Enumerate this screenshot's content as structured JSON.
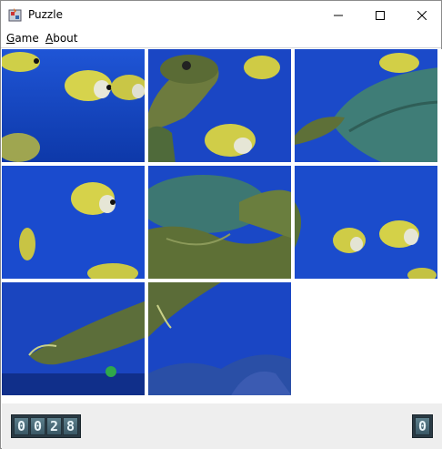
{
  "window": {
    "title": "Puzzle"
  },
  "menu": {
    "game": {
      "mnemonic": "G",
      "rest": "ame"
    },
    "about": {
      "mnemonic": "A",
      "rest": "bout"
    }
  },
  "icons": {
    "app": "puzzle-app-icon",
    "minimize": "minimize-icon",
    "maximize": "maximize-icon",
    "close": "close-icon"
  },
  "colors": {
    "water": "#1a47c8",
    "water_deep": "#0b2f9a",
    "fish_yellow": "#d9d24a",
    "turtle_shell": "#3f7f7a",
    "turtle_skin": "#6f8a4a",
    "digit_bg": "#4a6a78"
  },
  "board": {
    "rows": 3,
    "cols": 3,
    "tiles": [
      {
        "row": 0,
        "col": 0,
        "piece": 1,
        "label": "fish-school"
      },
      {
        "row": 0,
        "col": 1,
        "piece": 2,
        "label": "turtle-head"
      },
      {
        "row": 0,
        "col": 2,
        "piece": 3,
        "label": "turtle-back-flipper"
      },
      {
        "row": 1,
        "col": 0,
        "piece": 4,
        "label": "fish-school"
      },
      {
        "row": 1,
        "col": 1,
        "piece": 5,
        "label": "turtle-shell"
      },
      {
        "row": 1,
        "col": 2,
        "piece": 6,
        "label": "fish-school"
      },
      {
        "row": 2,
        "col": 0,
        "piece": 7,
        "label": "turtle-front-flipper"
      },
      {
        "row": 2,
        "col": 1,
        "piece": 8,
        "label": "turtle-flipper-reef"
      },
      {
        "row": 2,
        "col": 2,
        "piece": 0,
        "label": "empty"
      }
    ]
  },
  "status": {
    "moves_digits": [
      "0",
      "0",
      "2",
      "8"
    ],
    "solved_digits": [
      "0"
    ]
  }
}
